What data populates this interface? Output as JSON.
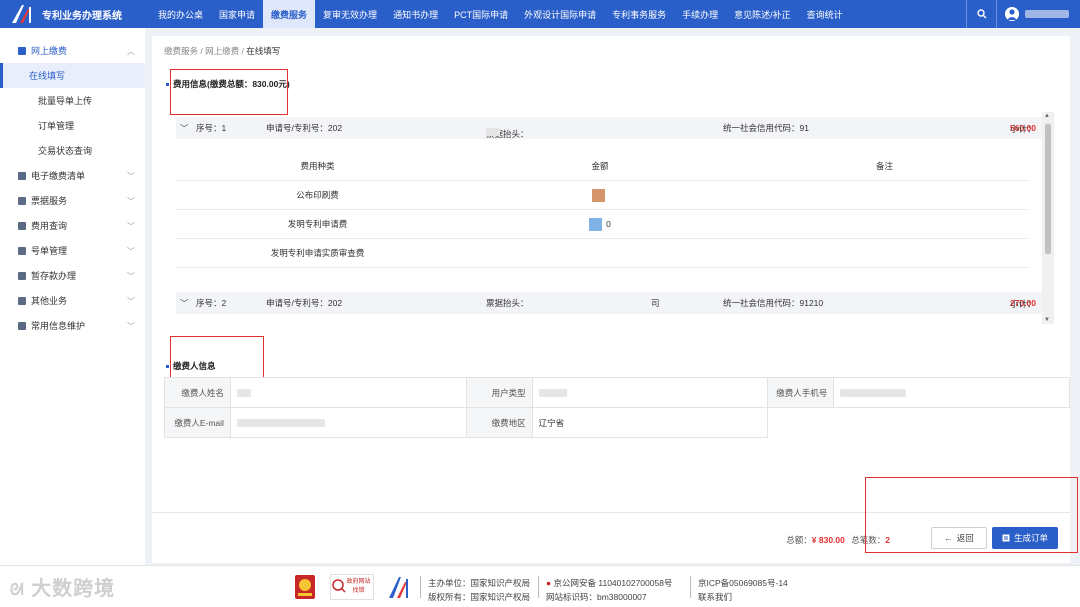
{
  "header": {
    "title": "专利业务办理系统",
    "nav": [
      "我的办公桌",
      "国家申请",
      "缴费服务",
      "复审无效办理",
      "通知书办理",
      "PCT国际申请",
      "外观设计国际申请",
      "专利事务服务",
      "手续办理",
      "意见陈述/补正",
      "查询统计"
    ],
    "active_nav": "缴费服务",
    "user_name": "██████"
  },
  "sidebar": {
    "groups": [
      {
        "label": "网上缴费",
        "open": true,
        "items": [
          "在线填写",
          "批量导单上传",
          "订单管理",
          "交易状态查询"
        ]
      },
      {
        "label": "电子缴费清单"
      },
      {
        "label": "票据服务"
      },
      {
        "label": "费用查询"
      },
      {
        "label": "号单管理"
      },
      {
        "label": "暂存款办理"
      },
      {
        "label": "其他业务"
      },
      {
        "label": "常用信息维护"
      }
    ],
    "active_item": "在线填写"
  },
  "breadcrumb": [
    "缴费服务",
    "网上缴费",
    "在线填写"
  ],
  "fee_section": {
    "title": "费用信息(缴费总额：830.00元)",
    "rows": [
      {
        "seq": "序号：1",
        "app_no": "申请号/专利号：202",
        "invoice": "票据抬头：",
        "credit_code": "统一社会信用代码：91",
        "subtotal_label": "小计：",
        "subtotal": "560.00"
      },
      {
        "seq": "序号：2",
        "app_no": "申请号/专利号：202",
        "invoice": "票据抬头：",
        "invoice_tail": "司",
        "credit_code": "统一社会信用代码：91210",
        "subtotal_label": "小计：",
        "subtotal": "270.00"
      }
    ],
    "table": {
      "headers": [
        "费用种类",
        "金额",
        "备注"
      ],
      "items": [
        {
          "type": "公布印刷费",
          "amount": "",
          "color": "#d4956b"
        },
        {
          "type": "发明专利申请费",
          "amount": "0",
          "color": "#7fb3e6"
        },
        {
          "type": "发明专利申请实质审查费",
          "amount": "",
          "color": ""
        }
      ]
    }
  },
  "payer_section": {
    "title": "缴费人信息",
    "fields": {
      "name_label": "缴费人姓名",
      "user_type_label": "用户类型",
      "phone_label": "缴费人手机号",
      "email_label": "缴费人E-mail",
      "region_label": "缴费地区",
      "region_value": "辽宁省"
    }
  },
  "bottom": {
    "total_label": "总额：",
    "total_value": "¥ 830.00",
    "count_label": "总笔数：",
    "count_value": "2",
    "back_label": "返回",
    "generate_label": "生成订单"
  },
  "footer": {
    "watermark": "大数跨境",
    "host": "主办单位：国家知识产权局",
    "copyright": "版权所有：国家知识产权局",
    "police": "京公网安备 11040102700058号",
    "site_id": "网站标识码：bm38000007",
    "icp": "京ICP备05069085号-14",
    "contact": "联系我们",
    "badge_text": "政府网站找错"
  },
  "colors": {
    "primary": "#2a5ec8",
    "danger": "#e03030",
    "highlight_box": "#e03030"
  }
}
